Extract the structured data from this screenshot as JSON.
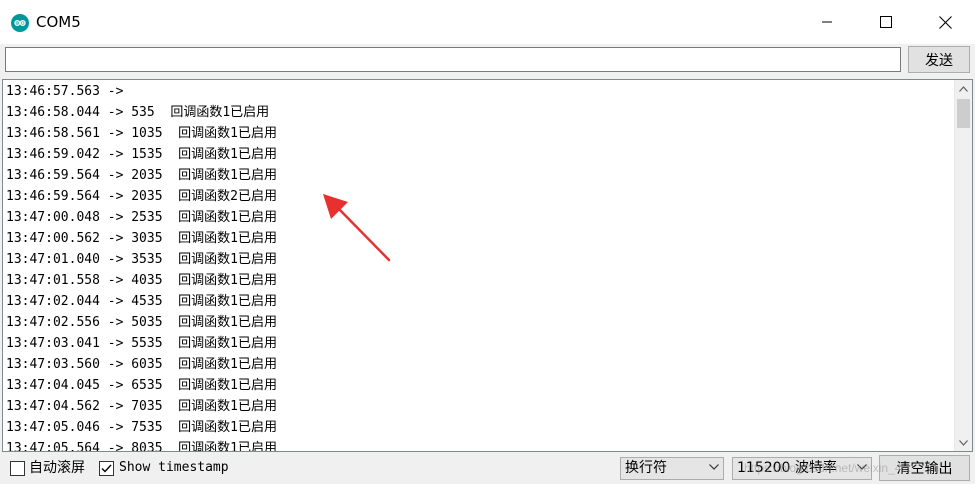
{
  "window": {
    "title": "COM5",
    "icon": "arduino-icon",
    "controls": [
      "minimize-icon",
      "maximize-icon",
      "close-icon"
    ]
  },
  "send_bar": {
    "input_value": "",
    "send_label": "发送"
  },
  "serial_output": {
    "lines": [
      "13:46:57.563 ->",
      "13:46:58.044 -> 535  回调函数1已启用",
      "13:46:58.561 -> 1035  回调函数1已启用",
      "13:46:59.042 -> 1535  回调函数1已启用",
      "13:46:59.564 -> 2035  回调函数1已启用",
      "13:46:59.564 -> 2035  回调函数2已启用",
      "13:47:00.048 -> 2535  回调函数1已启用",
      "13:47:00.562 -> 3035  回调函数1已启用",
      "13:47:01.040 -> 3535  回调函数1已启用",
      "13:47:01.558 -> 4035  回调函数1已启用",
      "13:47:02.044 -> 4535  回调函数1已启用",
      "13:47:02.556 -> 5035  回调函数1已启用",
      "13:47:03.041 -> 5535  回调函数1已启用",
      "13:47:03.560 -> 6035  回调函数1已启用",
      "13:47:04.045 -> 6535  回调函数1已启用",
      "13:47:04.562 -> 7035  回调函数1已启用",
      "13:47:05.046 -> 7535  回调函数1已启用",
      "13:47:05.564 -> 8035  回调函数1已启用"
    ],
    "annotation_color": "#e8312f"
  },
  "bottom_bar": {
    "autoscroll": {
      "label": "自动滚屏",
      "checked": false
    },
    "timestamp": {
      "label": "Show timestamp",
      "checked": true
    },
    "line_ending": "换行符",
    "baud_rate": "115200 波特率",
    "clear_label": "清空输出"
  },
  "watermark": "https://blog.csdn.net/weixin_4..."
}
